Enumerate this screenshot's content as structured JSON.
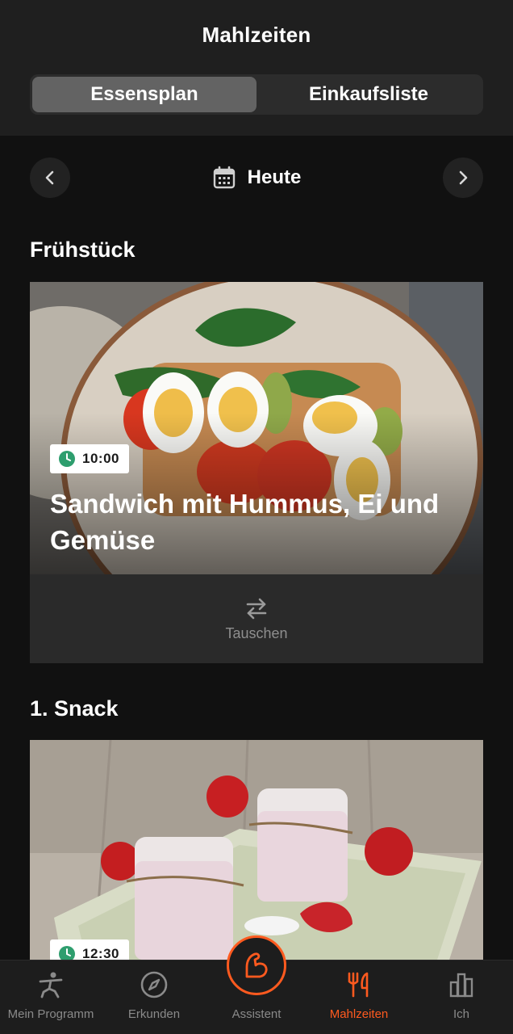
{
  "header": {
    "title": "Mahlzeiten",
    "tabs": [
      {
        "label": "Essensplan",
        "active": true
      },
      {
        "label": "Einkaufsliste",
        "active": false
      }
    ]
  },
  "date_nav": {
    "label": "Heute",
    "prev_icon": "chevron-left-icon",
    "next_icon": "chevron-right-icon",
    "calendar_icon": "calendar-icon"
  },
  "meals": [
    {
      "section": "Frühstück",
      "time": "10:00",
      "name": "Sandwich mit Hummus, Ei und Gemüse",
      "swap_label": "Tauschen"
    },
    {
      "section": "1. Snack",
      "time": "12:30"
    }
  ],
  "tabbar": {
    "items": [
      {
        "label": "Mein Programm",
        "icon": "exercise-figure-icon",
        "active": false
      },
      {
        "label": "Erkunden",
        "icon": "compass-icon",
        "active": false
      },
      {
        "label": "Assistent",
        "icon": "flexed-arm-icon",
        "active": false
      },
      {
        "label": "Mahlzeiten",
        "icon": "fork-knife-icon",
        "active": true
      },
      {
        "label": "Ich",
        "icon": "bar-chart-icon",
        "active": false
      }
    ]
  },
  "colors": {
    "accent": "#ff5a1f",
    "background": "#111111",
    "header": "#1f1f1f",
    "badge_clock": "#2e9e6e"
  }
}
